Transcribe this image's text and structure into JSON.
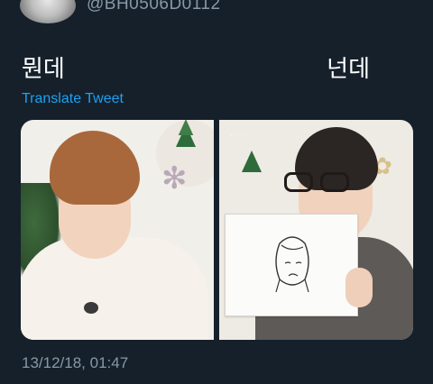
{
  "tweet": {
    "handle": "@BH0506D0112",
    "text_left": "뭔데",
    "text_right": "넌데",
    "translate_label": "Translate Tweet",
    "timestamp": "13/12/18, 01:47"
  },
  "colors": {
    "background": "#15202b",
    "link": "#1da1f2",
    "secondary_text": "#8899a6",
    "primary_text": "#ffffff"
  },
  "icons": {
    "left_photo_snowflake": "snowflake-decoration",
    "right_photo_tree": "christmas-tree-decoration"
  }
}
